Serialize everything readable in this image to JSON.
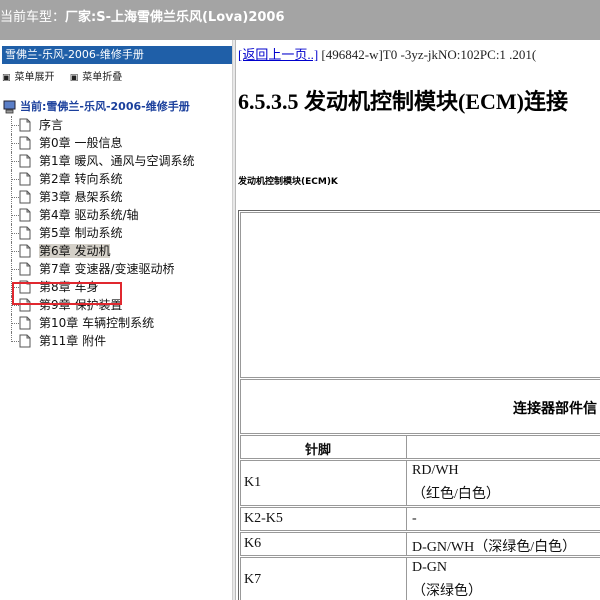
{
  "topbar": {
    "prefix": "当前车型：",
    "maker": "厂家:S-上海雪佛兰乐风(Lova)2006"
  },
  "sidebar": {
    "title": "雪佛兰-乐风-2006-维修手册",
    "expand_all": "菜单展开",
    "collapse_all": "菜单折叠",
    "root": "当前:雪佛兰-乐风-2006-维修手册",
    "items": [
      {
        "label": "序言"
      },
      {
        "label": "第0章 一般信息"
      },
      {
        "label": "第1章 暖风、通风与空调系统"
      },
      {
        "label": "第2章 转向系统"
      },
      {
        "label": "第3章 悬架系统"
      },
      {
        "label": "第4章 驱动系统/轴"
      },
      {
        "label": "第5章 制动系统"
      },
      {
        "label": "第6章 发动机"
      },
      {
        "label": "第7章 变速器/变速驱动桥"
      },
      {
        "label": "第8章 车身"
      },
      {
        "label": "第9章 保护装置"
      },
      {
        "label": "第10章 车辆控制系统"
      },
      {
        "label": "第11章 附件"
      }
    ]
  },
  "content": {
    "back_link": "[返回上一页..]",
    "meta": " [496842-w]T0 -3yz-jkNO:102PC:1 .201(",
    "heading": "6.5.3.5 发动机控制模块(ECM)连接",
    "subheading": "发动机控制模块(ECM)K",
    "table_header": "连接器部件信",
    "pin_header": "针脚",
    "rows": [
      {
        "pin": "K1",
        "line1": "RD/WH",
        "line2": "（红色/白色）"
      },
      {
        "pin": "K2-K5",
        "line1": "-",
        "line2": ""
      },
      {
        "pin": "K6",
        "line1": "D-GN/WH（深绿色/白色）",
        "line2": ""
      },
      {
        "pin": "K7",
        "line1": "D-GN",
        "line2": "（深绿色）"
      }
    ]
  },
  "colors": {
    "topbar_bg": "#a4a4a4",
    "panel_title_bg": "#1f5fa8",
    "link": "#0000cc",
    "highlight_box": "#e0282f"
  }
}
